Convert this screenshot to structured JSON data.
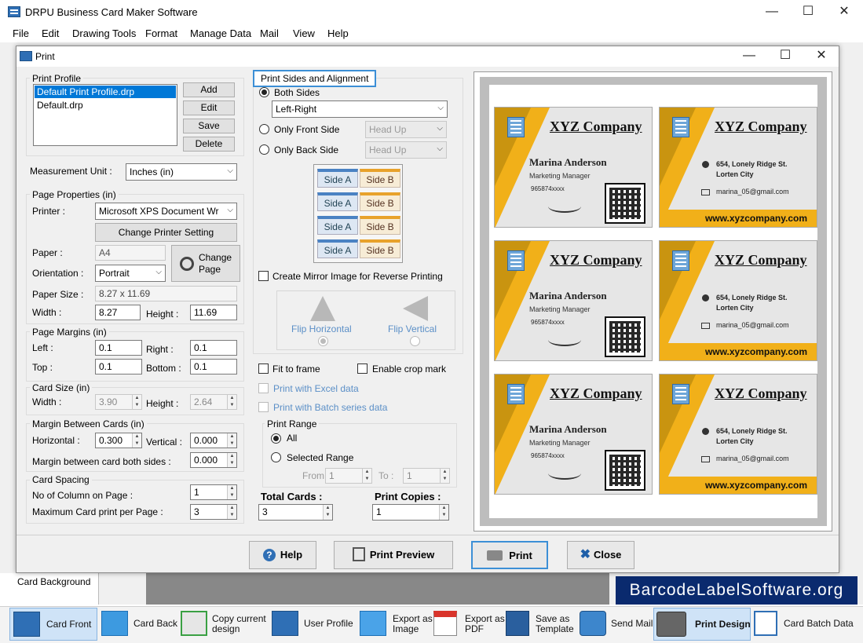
{
  "app": {
    "title": "DRPU Business Card Maker Software"
  },
  "menu": [
    "File",
    "Edit",
    "Drawing Tools",
    "Format",
    "Manage Data",
    "Mail",
    "View",
    "Help"
  ],
  "dialog": {
    "title": "Print"
  },
  "profile": {
    "label": "Print Profile",
    "items": [
      "Default Print Profile.drp",
      "Default.drp"
    ],
    "add": "Add",
    "edit": "Edit",
    "save": "Save",
    "delete": "Delete"
  },
  "measure": {
    "label": "Measurement Unit :",
    "value": "Inches (in)"
  },
  "page": {
    "label": "Page Properties (in)",
    "printer_label": "Printer :",
    "printer": "Microsoft XPS Document Wr",
    "change_printer": "Change Printer Setting",
    "paper_label": "Paper :",
    "paper": "A4",
    "change_page": "Change Page",
    "orient_label": "Orientation :",
    "orient": "Portrait",
    "size_label": "Paper Size :",
    "size": "8.27 x 11.69",
    "width_label": "Width :",
    "width": "8.27",
    "height_label": "Height :",
    "height": "11.69"
  },
  "margins": {
    "label": "Page Margins (in)",
    "left_label": "Left :",
    "left": "0.1",
    "right_label": "Right :",
    "right": "0.1",
    "top_label": "Top :",
    "top": "0.1",
    "bottom_label": "Bottom :",
    "bottom": "0.1"
  },
  "cardsize": {
    "label": "Card Size (in)",
    "width_label": "Width :",
    "width": "3.90",
    "height_label": "Height :",
    "height": "2.64"
  },
  "mbc": {
    "label": "Margin Between Cards (in)",
    "h_label": "Horizontal :",
    "h": "0.300",
    "v_label": "Vertical :",
    "v": "0.000",
    "both_label": "Margin between card both sides :",
    "both": "0.000"
  },
  "spacing": {
    "label": "Card Spacing",
    "cols_label": "No of Column on Page :",
    "cols": "1",
    "max_label": "Maximum Card print per Page :",
    "max": "3"
  },
  "sides": {
    "label": "Print Sides and Alignment",
    "both": "Both Sides",
    "both_mode": "Left-Right",
    "front": "Only Front Side",
    "back": "Only Back Side",
    "head": "Head Up",
    "side_a": "Side A",
    "side_b": "Side B",
    "mirror": "Create Mirror Image for Reverse Printing",
    "flip_h": "Flip Horizontal",
    "flip_v": "Flip Vertical"
  },
  "options": {
    "fit": "Fit to frame",
    "crop": "Enable crop mark",
    "excel": "Print with Excel data",
    "batch": "Print with Batch series data"
  },
  "range": {
    "label": "Print Range",
    "all": "All",
    "selected": "Selected Range",
    "from_label": "From :",
    "from": "1",
    "to_label": "To :",
    "to": "1"
  },
  "totals": {
    "total_label": "Total Cards :",
    "total": "3",
    "copies_label": "Print Copies :",
    "copies": "1"
  },
  "card": {
    "company": "XYZ Company",
    "name": "Marina Anderson",
    "role": "Marketing Manager",
    "phone": "965874xxxx",
    "addr1": "654, Lonely Ridge St.",
    "addr2": "Lorten City",
    "email": "marina_05@gmail.com",
    "web": "www.xyzcompany.com"
  },
  "buttons": {
    "help": "Help",
    "preview": "Print Preview",
    "print": "Print",
    "close": "Close"
  },
  "background": {
    "card_bg": "Card Background",
    "watermark": "BarcodeLabelSoftware.org"
  },
  "toolbar": {
    "card_front": "Card Front",
    "card_back": "Card Back",
    "copy1": "Copy current",
    "copy2": "design",
    "user_profile": "User Profile",
    "export_img1": "Export as",
    "export_img2": "Image",
    "export_pdf1": "Export as",
    "export_pdf2": "PDF",
    "save_tpl1": "Save as",
    "save_tpl2": "Template",
    "send_mail": "Send Mail",
    "print_design": "Print Design",
    "batch_data": "Card Batch Data"
  },
  "colors": {
    "accent": "#0a2a6e",
    "card_yellow": "#f1b019",
    "focus": "#3c8fd6"
  }
}
